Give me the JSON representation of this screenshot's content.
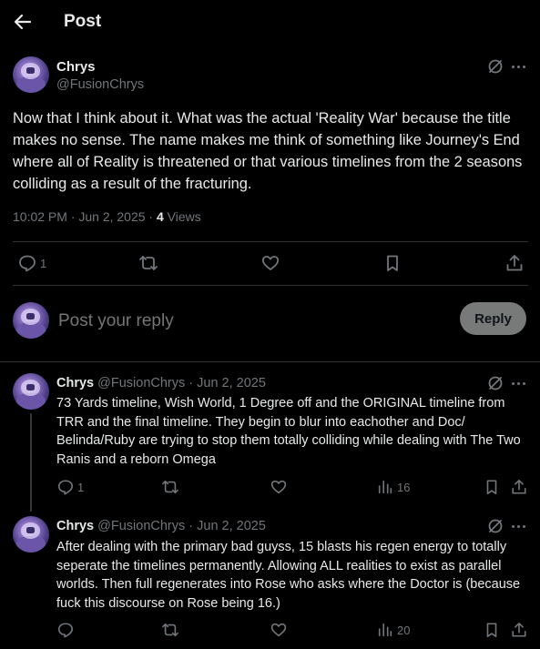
{
  "header": {
    "title": "Post",
    "back_icon": "arrow-left-icon"
  },
  "main_post": {
    "name": "Chrys",
    "handle": "@FusionChrys",
    "text": "Now that I think about it. What was the actual 'Reality War' because the title makes no sense. The name makes me think of something like Journey's End where all of Reality is threatened or that various timelines from the 2 seasons colliding as a result of the fracturing.",
    "timestamp": "10:02 PM · Jun 2, 2025 · ",
    "views_count": "4",
    "views_label": " Views",
    "reply_count": "1"
  },
  "composer": {
    "placeholder": "Post your reply",
    "button_label": "Reply"
  },
  "replies": [
    {
      "name": "Chrys",
      "handle_date": "@FusionChrys · Jun 2, 2025",
      "text": "73 Yards timeline, Wish World, 1 Degree off and the ORIGINAL timeline from TRR and the final timeline. They begin to blur into eachother and Doc/ Belinda/Ruby are trying to stop them totally colliding while dealing with The Two Ranis and a reborn Omega",
      "reply_count": "1",
      "views": "16"
    },
    {
      "name": "Chrys",
      "handle_date": "@FusionChrys · Jun 2, 2025",
      "text": "After dealing with the primary bad guyss, 15 blasts his regen energy to totally seperate the timelines permanently. Allowing ALL realities to exist as parallel worlds. Then full regenerates into Rose who asks where the Doctor is (because fuck this discourse on Rose being 16.)",
      "reply_count": "",
      "views": "20"
    }
  ],
  "colors": {
    "background": "#000000",
    "text": "#e7e9ea",
    "muted": "#71767b",
    "divider": "#2f3336",
    "reply_button": "#787a7a"
  }
}
